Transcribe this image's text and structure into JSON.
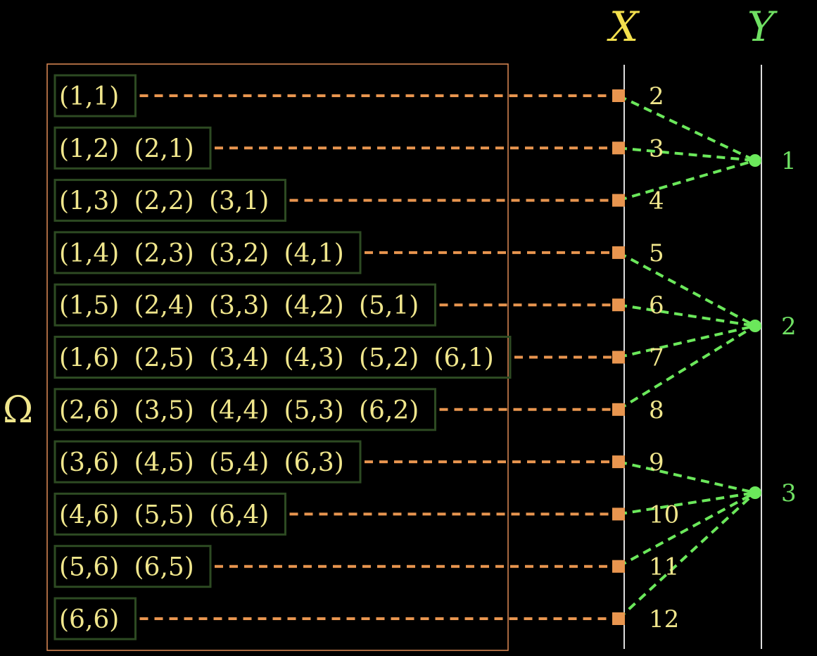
{
  "labels": {
    "omega": "Ω",
    "x_axis": "X",
    "y_axis": "Y"
  },
  "colors": {
    "background": "#000000",
    "outcome_text": "#f0e68c",
    "group_box_border": "#2d4a22",
    "omega_box_border": "#e08a55",
    "orange_connector": "#e8954f",
    "green_connector": "#6be85b",
    "axis_line": "#dddddd",
    "x_label": "#f4e04d",
    "y_label": "#6fe063"
  },
  "rows": [
    {
      "outcomes": [
        "(1,1)"
      ],
      "x": "2"
    },
    {
      "outcomes": [
        "(1,2)",
        "(2,1)"
      ],
      "x": "3"
    },
    {
      "outcomes": [
        "(1,3)",
        "(2,2)",
        "(3,1)"
      ],
      "x": "4"
    },
    {
      "outcomes": [
        "(1,4)",
        "(2,3)",
        "(3,2)",
        "(4,1)"
      ],
      "x": "5"
    },
    {
      "outcomes": [
        "(1,5)",
        "(2,4)",
        "(3,3)",
        "(4,2)",
        "(5,1)"
      ],
      "x": "6"
    },
    {
      "outcomes": [
        "(1,6)",
        "(2,5)",
        "(3,4)",
        "(4,3)",
        "(5,2)",
        "(6,1)"
      ],
      "x": "7"
    },
    {
      "outcomes": [
        "(2,6)",
        "(3,5)",
        "(4,4)",
        "(5,3)",
        "(6,2)"
      ],
      "x": "8"
    },
    {
      "outcomes": [
        "(3,6)",
        "(4,5)",
        "(5,4)",
        "(6,3)"
      ],
      "x": "9"
    },
    {
      "outcomes": [
        "(4,6)",
        "(5,5)",
        "(6,4)"
      ],
      "x": "10"
    },
    {
      "outcomes": [
        "(5,6)",
        "(6,5)"
      ],
      "x": "11"
    },
    {
      "outcomes": [
        "(6,6)"
      ],
      "x": "12"
    }
  ],
  "y_values": [
    {
      "label": "1",
      "from_rows": [
        0,
        1,
        2
      ]
    },
    {
      "label": "2",
      "from_rows": [
        3,
        4,
        5,
        6
      ]
    },
    {
      "label": "3",
      "from_rows": [
        7,
        8,
        9,
        10
      ]
    }
  ]
}
